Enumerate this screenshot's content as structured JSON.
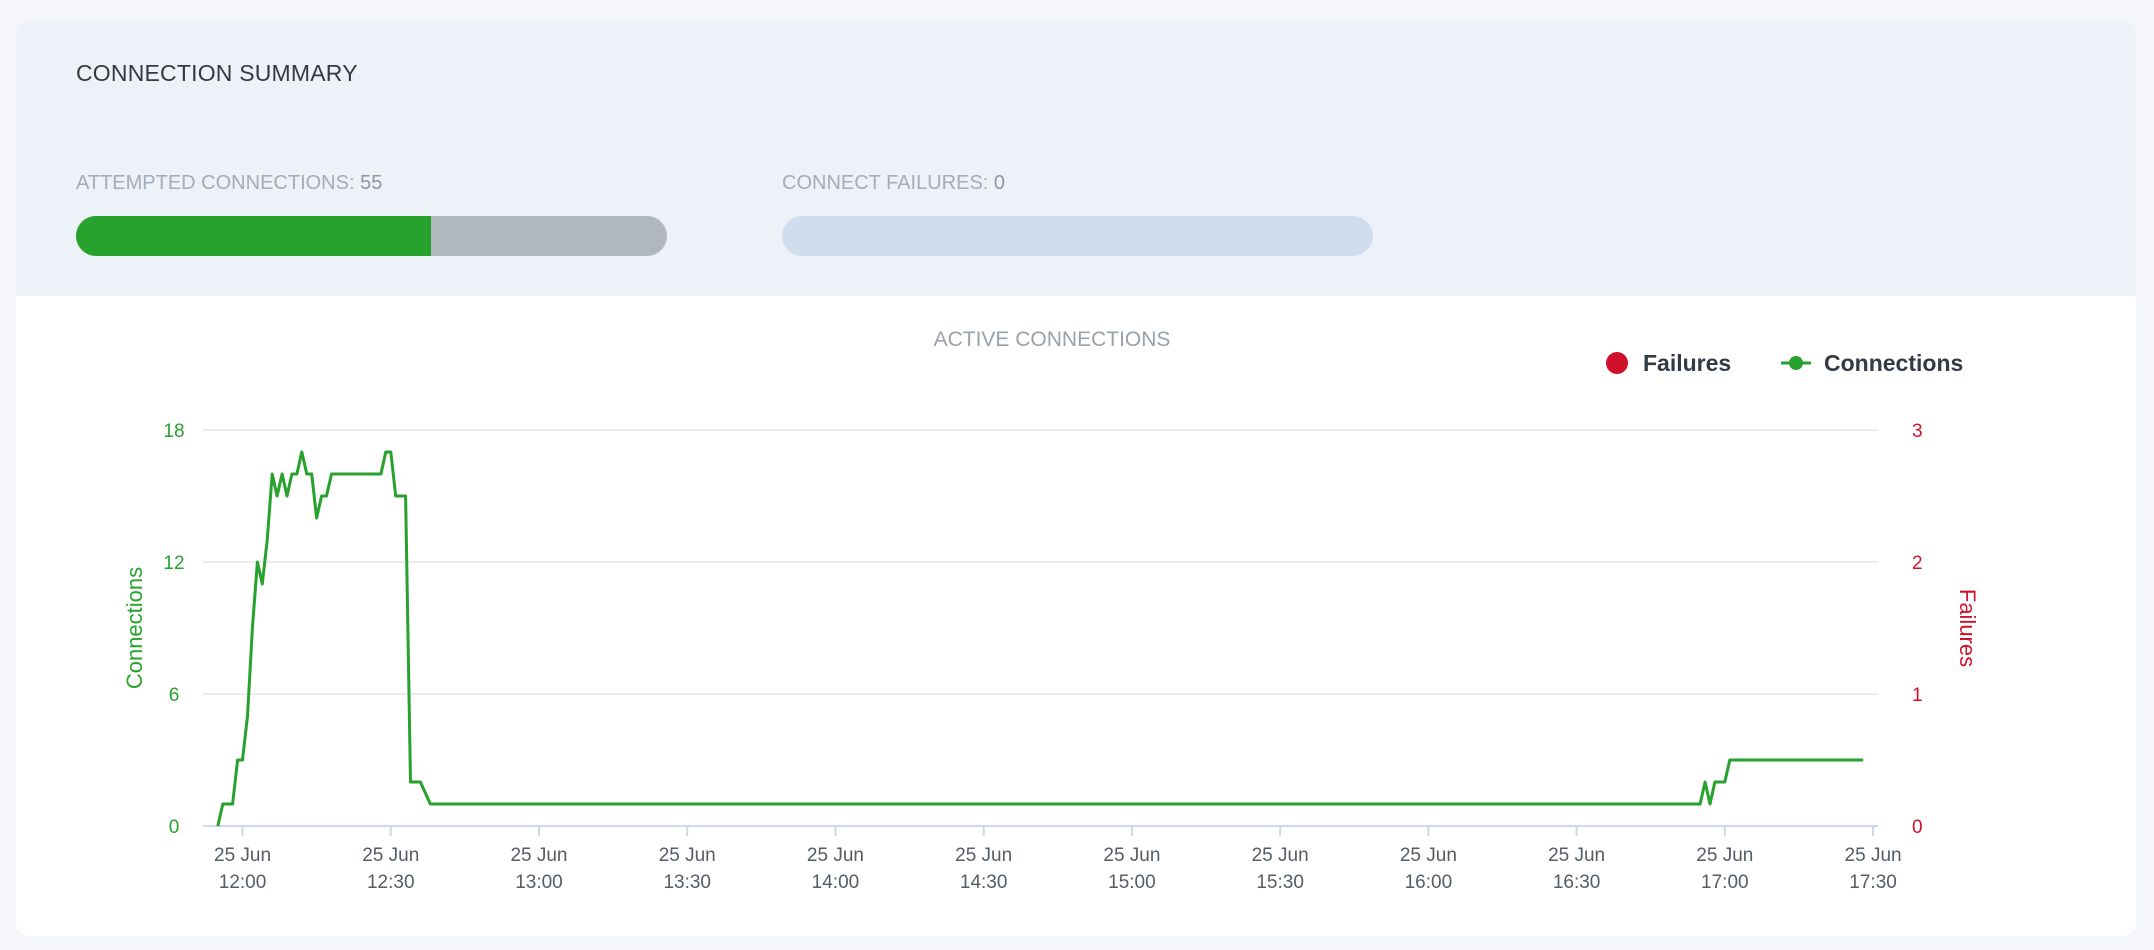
{
  "summary": {
    "title": "CONNECTION SUMMARY",
    "attempted": {
      "label": "ATTEMPTED CONNECTIONS: ",
      "value": "55",
      "fill_fraction": 0.6
    },
    "failures": {
      "label": "CONNECT FAILURES: ",
      "value": "0",
      "fill_fraction": 0
    }
  },
  "colors": {
    "connections": "#27a22d",
    "failures": "#d0112b",
    "fill_bg": "#b0b8bd",
    "failures_bg": "#d1dded"
  },
  "chart_data": {
    "type": "line",
    "title": "ACTIVE CONNECTIONS",
    "legend": {
      "placement": "top-right",
      "items": [
        "Failures",
        "Connections"
      ]
    },
    "grid": true,
    "x_ticks": [
      [
        "25 Jun",
        "12:00"
      ],
      [
        "25 Jun",
        "12:30"
      ],
      [
        "25 Jun",
        "13:00"
      ],
      [
        "25 Jun",
        "13:30"
      ],
      [
        "25 Jun",
        "14:00"
      ],
      [
        "25 Jun",
        "14:30"
      ],
      [
        "25 Jun",
        "15:00"
      ],
      [
        "25 Jun",
        "15:30"
      ],
      [
        "25 Jun",
        "16:00"
      ],
      [
        "25 Jun",
        "16:30"
      ],
      [
        "25 Jun",
        "17:00"
      ],
      [
        "25 Jun",
        "17:30"
      ]
    ],
    "y_left": {
      "label": "Connections",
      "ticks": [
        "0",
        "6",
        "12",
        "18"
      ],
      "range": [
        0,
        18
      ]
    },
    "y_right": {
      "label": "Failures",
      "ticks": [
        "0",
        "1",
        "2",
        "3"
      ],
      "range": [
        0,
        3
      ]
    },
    "series": [
      {
        "name": "Connections",
        "axis": "left",
        "x": [
          "11:55",
          "11:56",
          "11:58",
          "11:59",
          "12:00",
          "12:01",
          "12:02",
          "12:03",
          "12:04",
          "12:05",
          "12:06",
          "12:07",
          "12:08",
          "12:09",
          "12:10",
          "12:11",
          "12:12",
          "12:13",
          "12:14",
          "12:15",
          "12:16",
          "12:17",
          "12:18",
          "12:20",
          "12:22",
          "12:25",
          "12:28",
          "12:29",
          "12:30",
          "12:31",
          "12:32",
          "12:33",
          "12:34",
          "12:35",
          "12:36",
          "12:38",
          "12:40",
          "13:00",
          "14:00",
          "15:00",
          "16:00",
          "16:55",
          "16:56",
          "16:57",
          "16:58",
          "16:59",
          "17:00",
          "17:01",
          "17:02",
          "17:03",
          "17:05",
          "17:10",
          "17:20",
          "17:28"
        ],
        "y": [
          0,
          1,
          1,
          3,
          3,
          5,
          9,
          12,
          11,
          13,
          16,
          15,
          16,
          15,
          16,
          16,
          17,
          16,
          16,
          14,
          15,
          15,
          16,
          16,
          16,
          16,
          16,
          17,
          17,
          15,
          15,
          15,
          2,
          2,
          2,
          1,
          1,
          1,
          1,
          1,
          1,
          1,
          2,
          1,
          2,
          2,
          2,
          3,
          3,
          3,
          3,
          3,
          3,
          3
        ]
      },
      {
        "name": "Failures",
        "axis": "right",
        "x": [],
        "y": []
      }
    ]
  }
}
